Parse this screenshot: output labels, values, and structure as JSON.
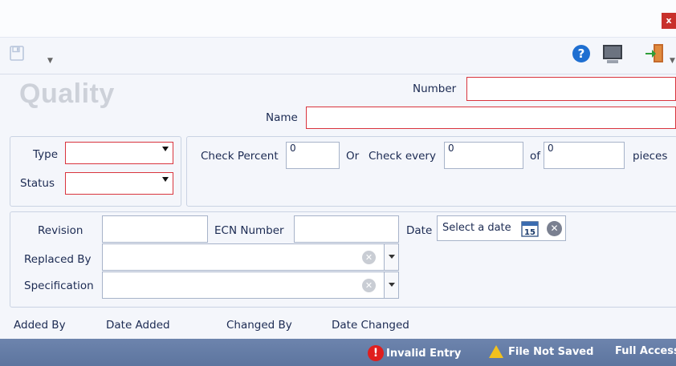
{
  "window": {
    "close_label": "x"
  },
  "title": "Quality",
  "form": {
    "number_label": "Number",
    "number_value": "",
    "name_label": "Name",
    "name_value": "",
    "type_label": "Type",
    "type_value": "",
    "status_label": "Status",
    "status_value": "",
    "check_percent_label": "Check Percent",
    "check_percent_value": "0",
    "or_label": "Or",
    "check_every_label": "Check every",
    "check_every_value": "0",
    "of_label": "of",
    "of_value": "0",
    "pieces_label": "pieces",
    "revision_label": "Revision",
    "revision_value": "",
    "ecn_label": "ECN Number",
    "ecn_value": "",
    "date_label": "Date",
    "date_placeholder": "Select a date",
    "calendar_day": "15",
    "replaced_by_label": "Replaced By",
    "replaced_by_value": "",
    "specification_label": "Specification",
    "specification_value": ""
  },
  "audit": {
    "added_by_label": "Added By",
    "date_added_label": "Date Added",
    "changed_by_label": "Changed By",
    "date_changed_label": "Date Changed"
  },
  "status_bar": {
    "invalid_entry": "Invalid Entry",
    "file_not_saved": "File Not Saved",
    "full_access": "Full Access"
  },
  "colors": {
    "required_border": "#d9343d",
    "status_bar": "#6a80a8",
    "close": "#c8312b"
  }
}
